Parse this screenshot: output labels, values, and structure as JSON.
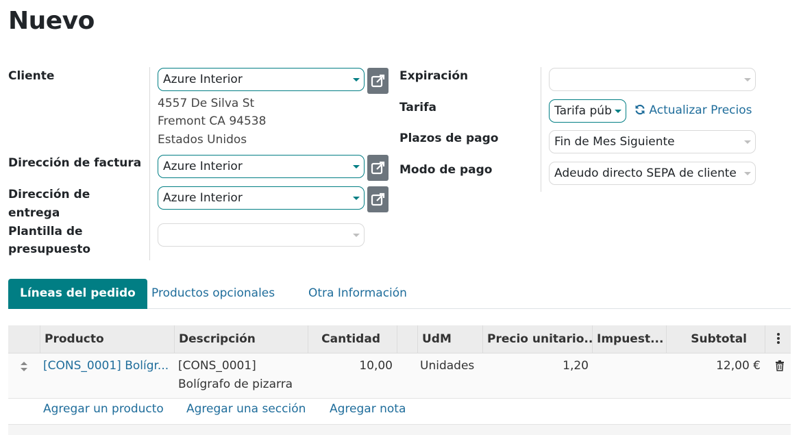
{
  "page": {
    "title": "Nuevo"
  },
  "form": {
    "left": {
      "cliente_label": "Cliente",
      "cliente_value": "Azure Interior",
      "address_line1": "4557 De Silva St",
      "address_line2": "Fremont CA 94538",
      "address_line3": "Estados Unidos",
      "factura_label": "Dirección de factura",
      "factura_value": "Azure Interior",
      "entrega_label_1": "Dirección de",
      "entrega_label_2": "entrega",
      "entrega_value": "Azure Interior",
      "plantilla_label_1": "Plantilla de",
      "plantilla_label_2": "presupuesto",
      "plantilla_value": ""
    },
    "right": {
      "expiracion_label": "Expiración",
      "expiracion_value": "",
      "tarifa_label": "Tarifa",
      "tarifa_value": "Tarifa púb",
      "actualizar_label": "Actualizar Precios",
      "plazos_label": "Plazos de pago",
      "plazos_value": "Fin de Mes Siguiente",
      "modo_label": "Modo de pago",
      "modo_value": "Adeudo directo SEPA de cliente"
    }
  },
  "tabs": [
    {
      "label": "Líneas del pedido",
      "active": true
    },
    {
      "label": "Productos opcionales",
      "active": false
    },
    {
      "label": "Otra Información",
      "active": false
    }
  ],
  "table": {
    "headers": {
      "producto": "Producto",
      "descripcion": "Descripción",
      "cantidad": "Cantidad",
      "udm": "UdM",
      "precio": "Precio unitario...",
      "impuestos": "Impuest...",
      "subtotal": "Subtotal"
    },
    "rows": [
      {
        "producto": "[CONS_0001] Bolígr...",
        "descripcion_1": "[CONS_0001]",
        "descripcion_2": "Bolígrafo de pizarra",
        "cantidad": "10,00",
        "udm": "Unidades",
        "precio": "1,20",
        "impuestos": "",
        "subtotal": "12,00 €"
      }
    ],
    "add_links": {
      "producto": "Agregar un producto",
      "seccion": "Agregar una sección",
      "nota": "Agregar nota"
    }
  },
  "colors": {
    "accent": "#017e84",
    "link": "#1f6d9b",
    "button_grey": "#6c757d"
  },
  "icons": [
    "external-link-icon",
    "caret-down-icon",
    "refresh-icon",
    "drag-handle-icon",
    "trash-icon",
    "kebab-menu-icon"
  ]
}
